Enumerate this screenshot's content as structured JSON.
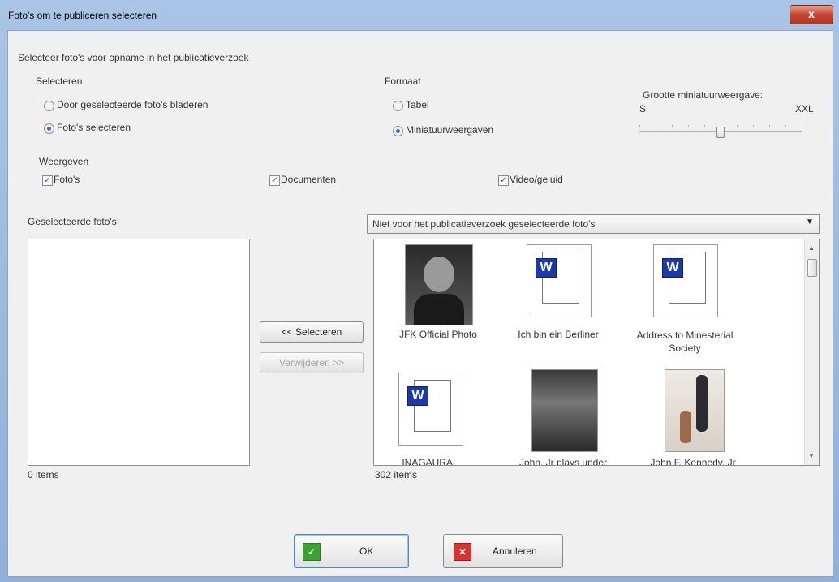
{
  "window": {
    "title": "Foto's om te publiceren selecteren",
    "close_glyph": "x"
  },
  "instruction": "Selecteer foto's voor opname in het publicatieverzoek",
  "select_group": {
    "label": "Selecteren",
    "options": [
      "Door geselecteerde foto's bladeren",
      "Foto's selecteren"
    ],
    "selected": "Foto's selecteren"
  },
  "format_group": {
    "label": "Formaat",
    "options": [
      "Tabel",
      "Miniatuurweergaven"
    ],
    "selected": "Miniatuurweergaven"
  },
  "thumb_size": {
    "label": "Grootte miniatuurweergave:",
    "min_label": "S",
    "max_label": "XXL",
    "level": 0.5
  },
  "show_group": {
    "label": "Weergeven",
    "items": [
      {
        "label": "Foto's",
        "checked": true
      },
      {
        "label": "Documenten",
        "checked": true
      },
      {
        "label": "Video/geluid",
        "checked": true
      }
    ]
  },
  "selected_list": {
    "label": "Geselecteerde foto's:",
    "count": "0 items"
  },
  "buttons": {
    "select": "<< Selecteren",
    "remove": "Verwijderen >>",
    "ok": "OK",
    "cancel": "Annuleren"
  },
  "available": {
    "dropdown": "Niet voor het publicatieverzoek geselecteerde foto's",
    "count": "302 items",
    "items": [
      {
        "caption": "JFK Official Photo",
        "kind": "photo"
      },
      {
        "caption": "Ich bin ein Berliner",
        "kind": "document"
      },
      {
        "caption": "Address to Minesterial Society",
        "kind": "document"
      },
      {
        "caption": "INAGAURAL",
        "kind": "document"
      },
      {
        "caption": "John, Jr plays under",
        "kind": "photo"
      },
      {
        "caption": "John F. Kennedy, Jr",
        "kind": "photo"
      }
    ]
  },
  "icons": {
    "ok": "check-icon",
    "cancel": "x-icon",
    "word": "word-document-icon"
  },
  "colors": {
    "ok_icon": "#3aa336",
    "cancel_icon": "#d9332b",
    "word_blue": "#1b3aa8",
    "close_red": "#c8452f"
  }
}
